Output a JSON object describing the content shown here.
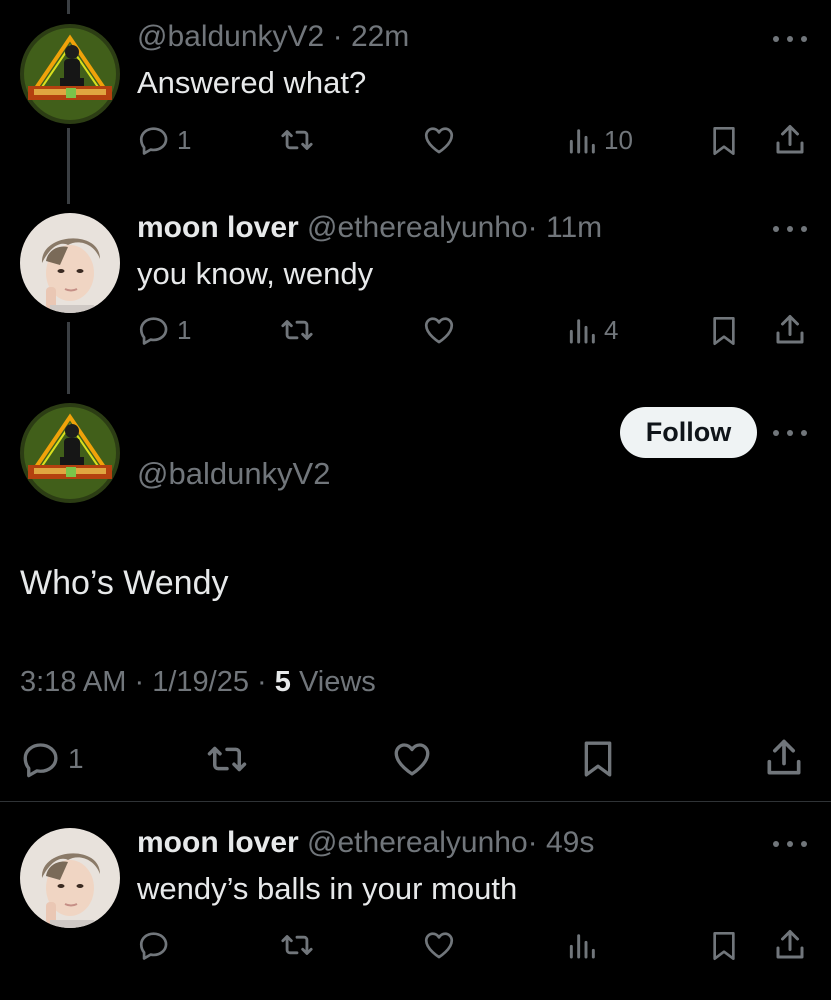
{
  "tweet1": {
    "handle": "@baldunkyV2",
    "sep": "·",
    "time": "22m",
    "text": "Answered what?",
    "replies": "1",
    "views": "10"
  },
  "tweet2": {
    "name": "moon lover",
    "handle": "@etherealyunho",
    "sep": "·",
    "time": "11m",
    "text": "you know, wendy",
    "replies": "1",
    "views": "4"
  },
  "main_tweet": {
    "handle": "@baldunkyV2",
    "follow_label": "Follow",
    "text": "Who’s Wendy",
    "time": "3:18 AM",
    "sep": "·",
    "date": "1/19/25",
    "views_count": "5",
    "views_label": "Views",
    "replies": "1"
  },
  "tweet4": {
    "name": "moon lover",
    "handle": "@etherealyunho",
    "sep": "·",
    "time": "49s",
    "text": "wendy’s balls in your mouth"
  },
  "colors": {
    "background": "#000000",
    "text": "#e7e9ea",
    "muted": "#71767b",
    "follow_bg": "#eff3f4"
  }
}
